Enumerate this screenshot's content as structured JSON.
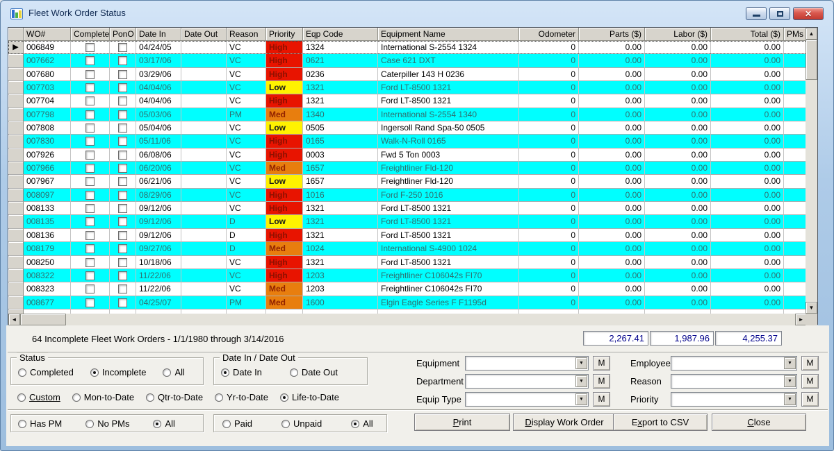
{
  "window": {
    "title": "Fleet Work Order Status"
  },
  "icons": {
    "app": "bar-chart",
    "close": "✕",
    "row_selector": "▶",
    "scroll_up": "▲",
    "scroll_down": "▼",
    "scroll_left": "◄",
    "scroll_right": "►",
    "dropdown": "▼"
  },
  "grid": {
    "columns": [
      "",
      "WO#",
      "Complete",
      "PonO",
      "Date In",
      "Date Out",
      "Reason",
      "Priority",
      "Eqp Code",
      "Equipment Name",
      "Odometer",
      "Parts ($)",
      "Labor ($)",
      "Total ($)",
      "PMs"
    ],
    "priority_colors": {
      "High": {
        "bg": "#e81400",
        "fg": "#8c1000"
      },
      "Med": {
        "bg": "#e87e0e",
        "fg": "#932300"
      },
      "Low": {
        "bg": "#fff200",
        "fg": "#1a1a1a"
      }
    },
    "rows": [
      {
        "selected": true,
        "wo": "006849",
        "complete": false,
        "pono": false,
        "date_in": "04/24/05",
        "date_out": "",
        "reason": "VC",
        "priority": "High",
        "eqp_code": "1324",
        "equipment_name": "International S-2554 1324",
        "odometer": "0",
        "parts": "0.00",
        "labor": "0.00",
        "total": "0.00",
        "pms": ""
      },
      {
        "selected": false,
        "wo": "007662",
        "complete": false,
        "pono": false,
        "date_in": "03/17/06",
        "date_out": "",
        "reason": "VC",
        "priority": "High",
        "eqp_code": "0621",
        "equipment_name": "Case 621 DXT",
        "odometer": "0",
        "parts": "0.00",
        "labor": "0.00",
        "total": "0.00",
        "pms": ""
      },
      {
        "selected": false,
        "wo": "007680",
        "complete": false,
        "pono": false,
        "date_in": "03/29/06",
        "date_out": "",
        "reason": "VC",
        "priority": "High",
        "eqp_code": "0236",
        "equipment_name": "Caterpiller 143 H 0236",
        "odometer": "0",
        "parts": "0.00",
        "labor": "0.00",
        "total": "0.00",
        "pms": ""
      },
      {
        "selected": false,
        "wo": "007703",
        "complete": false,
        "pono": false,
        "date_in": "04/04/06",
        "date_out": "",
        "reason": "VC",
        "priority": "Low",
        "eqp_code": "1321",
        "equipment_name": "Ford LT-8500 1321",
        "odometer": "0",
        "parts": "0.00",
        "labor": "0.00",
        "total": "0.00",
        "pms": ""
      },
      {
        "selected": false,
        "wo": "007704",
        "complete": false,
        "pono": false,
        "date_in": "04/04/06",
        "date_out": "",
        "reason": "VC",
        "priority": "High",
        "eqp_code": "1321",
        "equipment_name": "Ford LT-8500 1321",
        "odometer": "0",
        "parts": "0.00",
        "labor": "0.00",
        "total": "0.00",
        "pms": ""
      },
      {
        "selected": false,
        "wo": "007798",
        "complete": false,
        "pono": false,
        "date_in": "05/03/06",
        "date_out": "",
        "reason": "PM",
        "priority": "Med",
        "eqp_code": "1340",
        "equipment_name": "International S-2554 1340",
        "odometer": "0",
        "parts": "0.00",
        "labor": "0.00",
        "total": "0.00",
        "pms": ""
      },
      {
        "selected": false,
        "wo": "007808",
        "complete": false,
        "pono": false,
        "date_in": "05/04/06",
        "date_out": "",
        "reason": "VC",
        "priority": "Low",
        "eqp_code": "0505",
        "equipment_name": "Ingersoll Rand Spa-50 0505",
        "odometer": "0",
        "parts": "0.00",
        "labor": "0.00",
        "total": "0.00",
        "pms": ""
      },
      {
        "selected": false,
        "wo": "007830",
        "complete": false,
        "pono": false,
        "date_in": "05/11/06",
        "date_out": "",
        "reason": "VC",
        "priority": "High",
        "eqp_code": "0165",
        "equipment_name": "Walk-N-Roll  0165",
        "odometer": "0",
        "parts": "0.00",
        "labor": "0.00",
        "total": "0.00",
        "pms": ""
      },
      {
        "selected": false,
        "wo": "007926",
        "complete": false,
        "pono": false,
        "date_in": "06/08/06",
        "date_out": "",
        "reason": "VC",
        "priority": "High",
        "eqp_code": "0003",
        "equipment_name": "Fwd 5 Ton 0003",
        "odometer": "0",
        "parts": "0.00",
        "labor": "0.00",
        "total": "0.00",
        "pms": ""
      },
      {
        "selected": false,
        "wo": "007966",
        "complete": false,
        "pono": false,
        "date_in": "06/20/06",
        "date_out": "",
        "reason": "VC",
        "priority": "Med",
        "eqp_code": "1657",
        "equipment_name": "Freightliner Fld-120",
        "odometer": "0",
        "parts": "0.00",
        "labor": "0.00",
        "total": "0.00",
        "pms": ""
      },
      {
        "selected": false,
        "wo": "007967",
        "complete": false,
        "pono": false,
        "date_in": "06/21/06",
        "date_out": "",
        "reason": "VC",
        "priority": "Low",
        "eqp_code": "1657",
        "equipment_name": "Freightliner Fld-120",
        "odometer": "0",
        "parts": "0.00",
        "labor": "0.00",
        "total": "0.00",
        "pms": ""
      },
      {
        "selected": false,
        "wo": "008097",
        "complete": false,
        "pono": false,
        "date_in": "08/29/06",
        "date_out": "",
        "reason": "VC",
        "priority": "High",
        "eqp_code": "1016",
        "equipment_name": "Ford F-250 1016",
        "odometer": "0",
        "parts": "0.00",
        "labor": "0.00",
        "total": "0.00",
        "pms": ""
      },
      {
        "selected": false,
        "wo": "008133",
        "complete": false,
        "pono": false,
        "date_in": "09/12/06",
        "date_out": "",
        "reason": "VC",
        "priority": "High",
        "eqp_code": "1321",
        "equipment_name": "Ford LT-8500 1321",
        "odometer": "0",
        "parts": "0.00",
        "labor": "0.00",
        "total": "0.00",
        "pms": ""
      },
      {
        "selected": false,
        "wo": "008135",
        "complete": false,
        "pono": false,
        "date_in": "09/12/06",
        "date_out": "",
        "reason": "D",
        "priority": "Low",
        "eqp_code": "1321",
        "equipment_name": "Ford LT-8500 1321",
        "odometer": "0",
        "parts": "0.00",
        "labor": "0.00",
        "total": "0.00",
        "pms": ""
      },
      {
        "selected": false,
        "wo": "008136",
        "complete": false,
        "pono": false,
        "date_in": "09/12/06",
        "date_out": "",
        "reason": "D",
        "priority": "High",
        "eqp_code": "1321",
        "equipment_name": "Ford LT-8500 1321",
        "odometer": "0",
        "parts": "0.00",
        "labor": "0.00",
        "total": "0.00",
        "pms": ""
      },
      {
        "selected": false,
        "wo": "008179",
        "complete": false,
        "pono": false,
        "date_in": "09/27/06",
        "date_out": "",
        "reason": "D",
        "priority": "Med",
        "eqp_code": "1024",
        "equipment_name": "International S-4900 1024",
        "odometer": "0",
        "parts": "0.00",
        "labor": "0.00",
        "total": "0.00",
        "pms": ""
      },
      {
        "selected": false,
        "wo": "008250",
        "complete": false,
        "pono": false,
        "date_in": "10/18/06",
        "date_out": "",
        "reason": "VC",
        "priority": "High",
        "eqp_code": "1321",
        "equipment_name": "Ford LT-8500 1321",
        "odometer": "0",
        "parts": "0.00",
        "labor": "0.00",
        "total": "0.00",
        "pms": ""
      },
      {
        "selected": false,
        "wo": "008322",
        "complete": false,
        "pono": false,
        "date_in": "11/22/06",
        "date_out": "",
        "reason": "VC",
        "priority": "High",
        "eqp_code": "1203",
        "equipment_name": "Freightliner C106042s FI70",
        "odometer": "0",
        "parts": "0.00",
        "labor": "0.00",
        "total": "0.00",
        "pms": ""
      },
      {
        "selected": false,
        "wo": "008323",
        "complete": false,
        "pono": false,
        "date_in": "11/22/06",
        "date_out": "",
        "reason": "VC",
        "priority": "Med",
        "eqp_code": "1203",
        "equipment_name": "Freightliner C106042s FI70",
        "odometer": "0",
        "parts": "0.00",
        "labor": "0.00",
        "total": "0.00",
        "pms": ""
      },
      {
        "selected": false,
        "wo": "008677",
        "complete": false,
        "pono": false,
        "date_in": "04/25/07",
        "date_out": "",
        "reason": "PM",
        "priority": "Med",
        "eqp_code": "1600",
        "equipment_name": "Elgin Eagle Series F F1195d",
        "odometer": "0",
        "parts": "0.00",
        "labor": "0.00",
        "total": "0.00",
        "pms": ""
      }
    ]
  },
  "summary": {
    "text": "64 Incomplete Fleet Work Orders - 1/1/1980  through  3/14/2016",
    "parts_total": "2,267.41",
    "labor_total": "1,987.96",
    "grand_total": "4,255.37"
  },
  "filters": {
    "status_group": {
      "label": "Status",
      "options": [
        {
          "label": "Completed",
          "selected": false
        },
        {
          "label": "Incomplete",
          "selected": true
        },
        {
          "label": "All",
          "selected": false
        }
      ]
    },
    "date_group": {
      "label": "Date In / Date Out",
      "options": [
        {
          "label": "Date In",
          "selected": true
        },
        {
          "label": "Date Out",
          "selected": false
        }
      ]
    },
    "range_options": [
      {
        "label": "Custom",
        "selected": false,
        "underline": true
      },
      {
        "label": "Mon-to-Date",
        "selected": false
      },
      {
        "label": "Qtr-to-Date",
        "selected": false
      },
      {
        "label": "Yr-to-Date",
        "selected": false
      },
      {
        "label": "Life-to-Date",
        "selected": true
      }
    ],
    "pm_group": {
      "options": [
        {
          "label": "Has PM",
          "selected": false
        },
        {
          "label": "No PMs",
          "selected": false
        },
        {
          "label": "All",
          "selected": true
        }
      ]
    },
    "paid_group": {
      "options": [
        {
          "label": "Paid",
          "selected": false
        },
        {
          "label": "Unpaid",
          "selected": false
        },
        {
          "label": "All",
          "selected": true
        }
      ]
    },
    "combos_left": [
      {
        "label": "Equipment",
        "value": "",
        "m_label": "M"
      },
      {
        "label": "Department",
        "value": "",
        "m_label": "M"
      },
      {
        "label": "Equip Type",
        "value": "",
        "m_label": "M"
      }
    ],
    "combos_right": [
      {
        "label": "Employee",
        "value": "",
        "m_label": "M"
      },
      {
        "label": "Reason",
        "value": "",
        "m_label": "M"
      },
      {
        "label": "Priority",
        "value": "",
        "m_label": "M"
      }
    ]
  },
  "buttons": [
    {
      "label": "Print",
      "mnemonic": "P"
    },
    {
      "label": "Display Work Order",
      "mnemonic": "D"
    },
    {
      "label": "Export to CSV",
      "mnemonic": "x"
    },
    {
      "label": "Close",
      "mnemonic": "C"
    }
  ]
}
